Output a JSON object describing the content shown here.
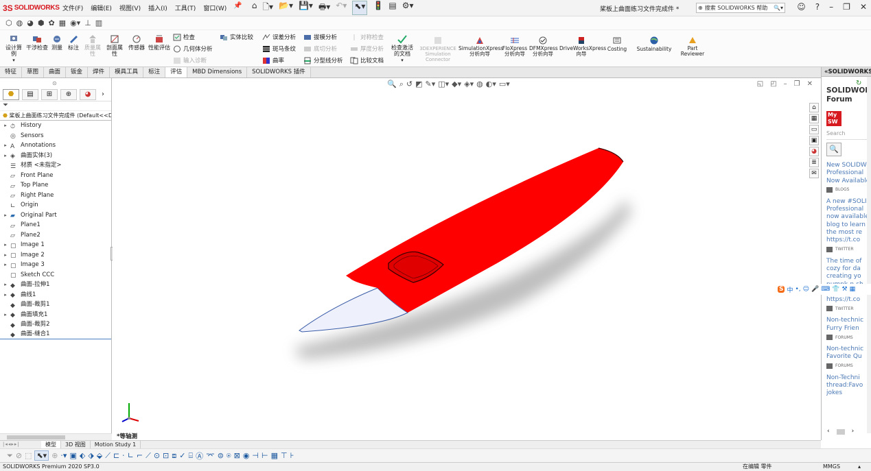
{
  "app": {
    "logo_mark": "3S",
    "logo_text": "SOLIDWORKS",
    "menu": [
      "文件(F)",
      "编辑(E)",
      "视图(V)",
      "插入(I)",
      "工具(T)",
      "窗口(W)"
    ],
    "document_title": "桨板上曲面练习文件完成件 *",
    "help_search_placeholder": "搜索 SOLIDWORKS 帮助"
  },
  "ribbon": {
    "large_buttons": [
      {
        "label": "设计算例"
      },
      {
        "label": "干涉检查"
      },
      {
        "label": "测量"
      },
      {
        "label": "标注"
      },
      {
        "label": "质量属性",
        "disabled": true
      },
      {
        "label": "剖面属性"
      },
      {
        "label": "传感器"
      },
      {
        "label": "性能评估"
      }
    ],
    "small_buttons_col1": [
      {
        "label": "检查"
      },
      {
        "label": "几何体分析"
      },
      {
        "label": "输入诊断",
        "disabled": true
      }
    ],
    "compare": {
      "label": "实体比较"
    },
    "small_buttons_col2": [
      {
        "label": "误差分析"
      },
      {
        "label": "斑马条纹"
      },
      {
        "label": "曲率"
      }
    ],
    "small_buttons_col3": [
      {
        "label": "拔模分析"
      },
      {
        "label": "底切分析",
        "disabled": true
      },
      {
        "label": "分型线分析"
      }
    ],
    "small_buttons_col4": [
      {
        "label": "对称检查",
        "disabled": true
      },
      {
        "label": "厚度分析",
        "disabled": true
      },
      {
        "label": "比较文档"
      }
    ],
    "check_active": {
      "label": "检查激活的文档"
    },
    "addins": [
      {
        "label": "3DEXPERIENCE Simulation Connector",
        "disabled": true
      },
      {
        "label": "SimulationXpress 分析向导"
      },
      {
        "label": "FloXpress 分析向导"
      },
      {
        "label": "DFMXpress 分析向导"
      },
      {
        "label": "DriveWorksXpress 向导"
      },
      {
        "label": "Costing"
      },
      {
        "label": "Sustainability"
      },
      {
        "label": "Part Reviewer"
      }
    ]
  },
  "tabs": [
    "特征",
    "草图",
    "曲面",
    "钣金",
    "焊件",
    "模具工具",
    "标注",
    "评估",
    "MBD Dimensions",
    "SOLIDWORKS 插件"
  ],
  "active_tab": 7,
  "feature_tree": {
    "root": "桨板上曲面练习文件完成件  (Default<<Default>",
    "items": [
      {
        "label": "History",
        "expand": true
      },
      {
        "label": "Sensors",
        "expand": false
      },
      {
        "label": "Annotations",
        "expand": true
      },
      {
        "label": "曲面实体(3)",
        "expand": true
      },
      {
        "label": "材质 <未指定>",
        "expand": false
      },
      {
        "label": "Front Plane",
        "expand": false
      },
      {
        "label": "Top Plane",
        "expand": false
      },
      {
        "label": "Right Plane",
        "expand": false
      },
      {
        "label": "Origin",
        "expand": false
      },
      {
        "label": "Original Part",
        "expand": true
      },
      {
        "label": "Plane1",
        "expand": false
      },
      {
        "label": "Plane2",
        "expand": false
      },
      {
        "label": "Image 1",
        "expand": true
      },
      {
        "label": "Image 2",
        "expand": true
      },
      {
        "label": "Image 3",
        "expand": true
      },
      {
        "label": "Sketch CCC",
        "expand": false
      },
      {
        "label": "曲面-拉伸1",
        "expand": true
      },
      {
        "label": "曲线1",
        "expand": true
      },
      {
        "label": "曲面-裁剪1",
        "expand": false
      },
      {
        "label": "曲面填充1",
        "expand": true
      },
      {
        "label": "曲面-裁剪2",
        "expand": false
      },
      {
        "label": "曲面-缝合1",
        "expand": false
      }
    ]
  },
  "viewport": {
    "orientation_label": "*等轴测",
    "colors": {
      "body": "#ff0000",
      "tip": "#eef1fb"
    }
  },
  "task_pane": {
    "header": "SOLIDWORKS",
    "title_lines": [
      "SOLIDWORKS",
      "Forum"
    ],
    "mysw": [
      "My",
      "SW"
    ],
    "search_placeholder": "Search",
    "feed": [
      {
        "lines": [
          "New SOLIDWORKS",
          "Professional",
          "Now Available"
        ],
        "tag": "BLOGS"
      },
      {
        "lines": [
          "A new #SOLIDWORKS",
          "Professional",
          "now available",
          "blog to learn",
          "the most re",
          "https://t.co"
        ],
        "tag": "TWITTER"
      },
      {
        "lines": [
          "The time of",
          "cozy for da",
          "creating yo",
          "pumpk-n-sh",
          "pumpkin pi",
          "https://t.co"
        ],
        "tag": "TWITTER"
      },
      {
        "lines": [
          "Non-technic",
          "Furry Frien"
        ],
        "tag": "FORUMS"
      },
      {
        "lines": [
          "Non-technic",
          "Favorite Qu"
        ],
        "tag": "FORUMS"
      },
      {
        "lines": [
          "Non-Techni",
          "thread:Favo",
          "jokes"
        ],
        "tag": ""
      }
    ]
  },
  "ime": {
    "logo": "S",
    "lang": "中"
  },
  "bottom_tabs": [
    "模型",
    "3D 视图",
    "Motion Study 1"
  ],
  "status": {
    "product": "SOLIDWORKS Premium 2020 SP3.0",
    "state": "在编辑 零件",
    "units": "MMGS",
    "units_arrow": "▴"
  }
}
